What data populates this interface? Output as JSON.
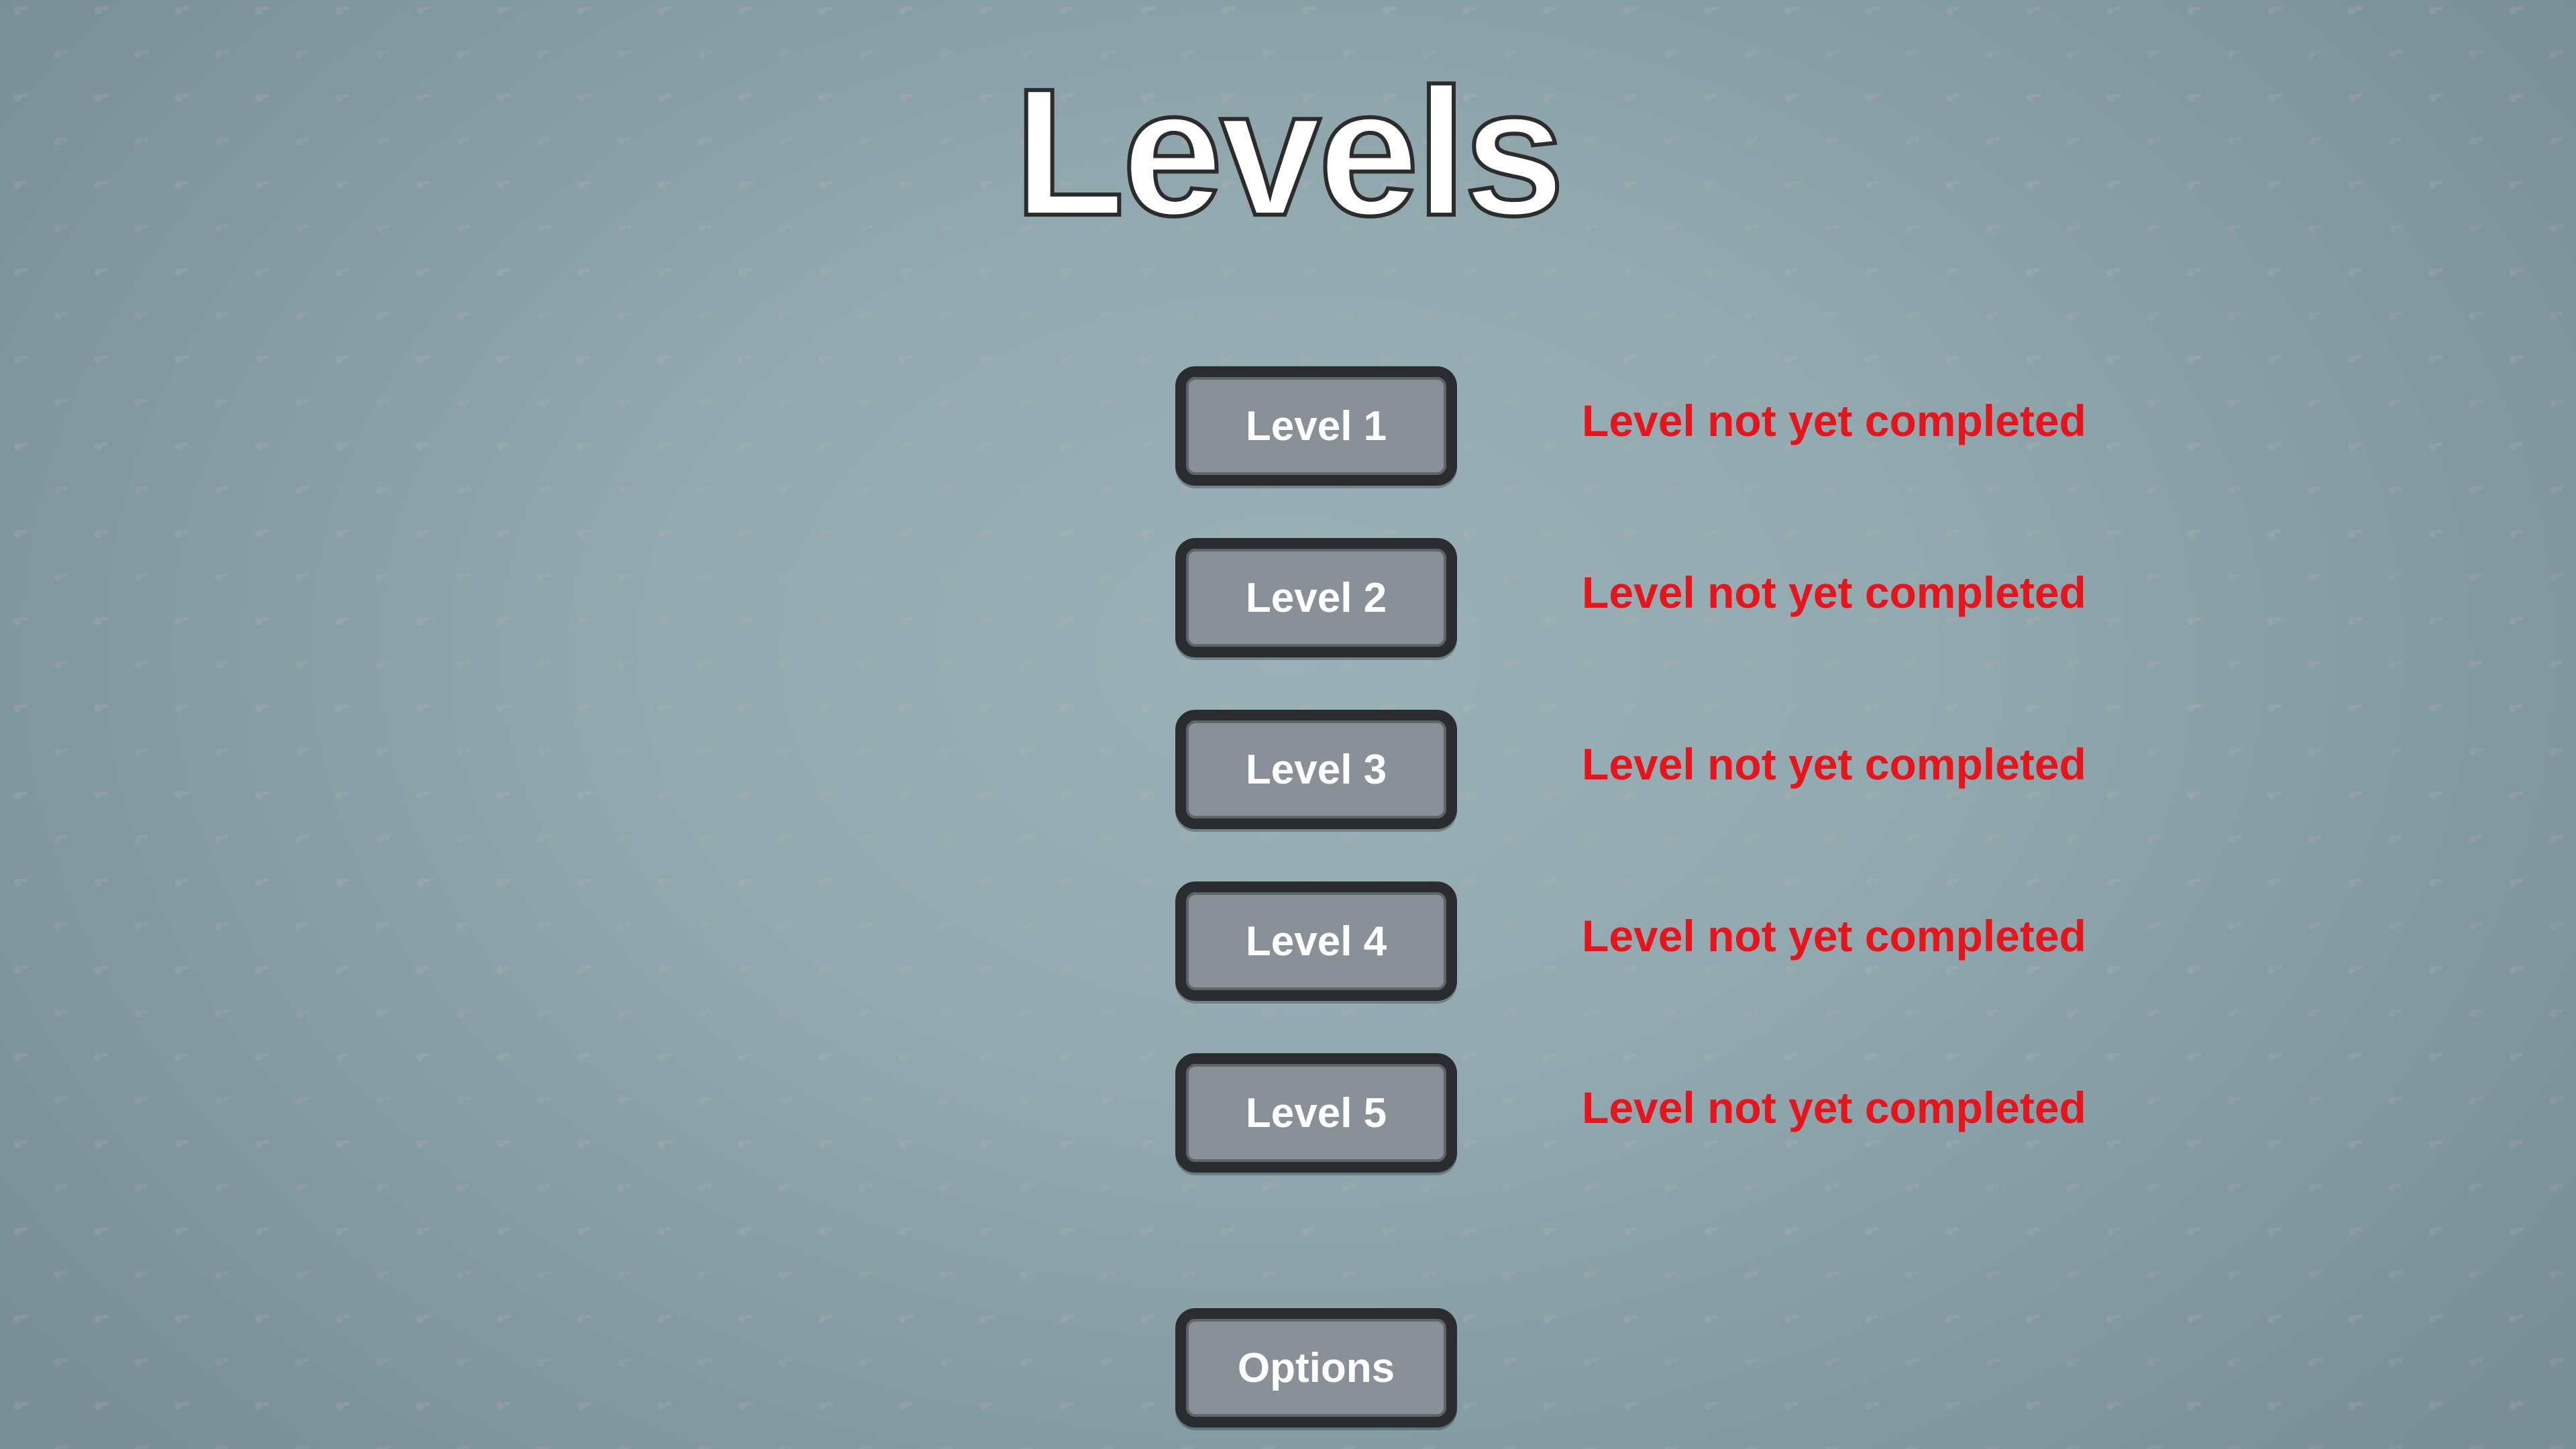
{
  "screen": {
    "title": "Levels"
  },
  "levels": [
    {
      "label": "Level 1",
      "status": "Level not yet completed"
    },
    {
      "label": "Level 2",
      "status": "Level not yet completed"
    },
    {
      "label": "Level 3",
      "status": "Level not yet completed"
    },
    {
      "label": "Level 4",
      "status": "Level not yet completed"
    },
    {
      "label": "Level 5",
      "status": "Level not yet completed"
    }
  ],
  "options": {
    "label": "Options"
  },
  "colors": {
    "status_incomplete": "#e8141b",
    "button_fill": "#8a9098",
    "button_border": "#2b2c2f",
    "background": "#92a9b0"
  }
}
